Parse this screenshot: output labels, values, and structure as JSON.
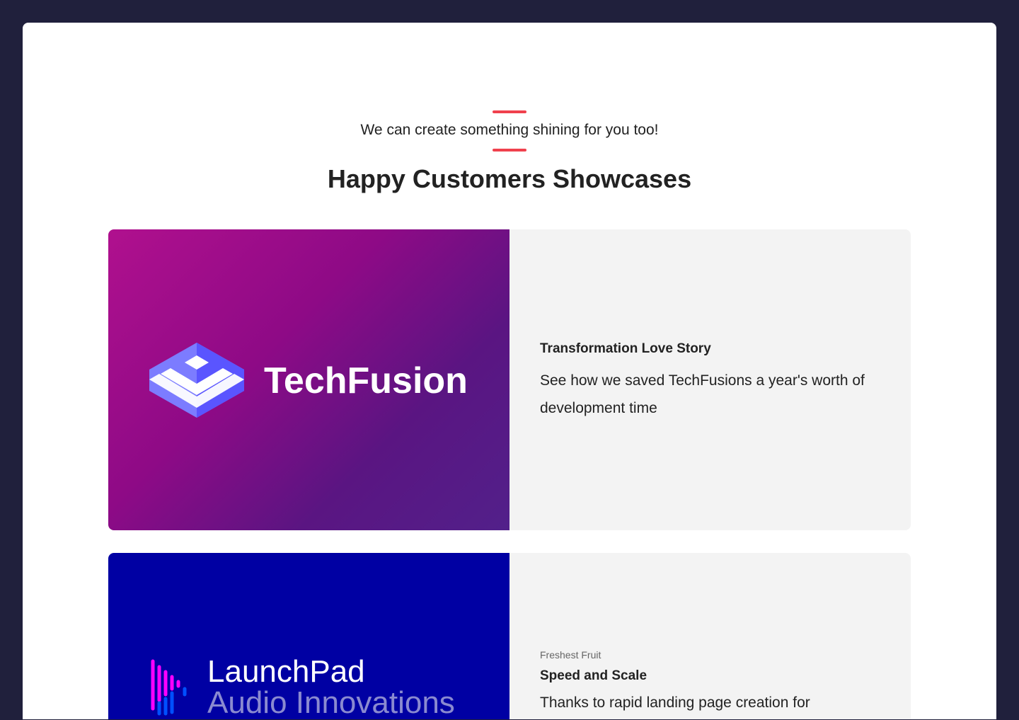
{
  "header": {
    "kicker": "We can create something shining for you too!",
    "title": "Happy Customers Showcases"
  },
  "showcases": [
    {
      "logo": "TechFusion",
      "title": "Transformation Love Story",
      "description": "See how we saved TechFusions a year's worth of development time"
    },
    {
      "logo": "LaunchPad",
      "logo_sub": "Audio Innovations",
      "label": "Freshest Fruit",
      "title": "Speed and Scale",
      "description": "Thanks to rapid landing page creation for"
    }
  ],
  "colors": {
    "accent": "#f0414d",
    "background": "#20203c"
  }
}
